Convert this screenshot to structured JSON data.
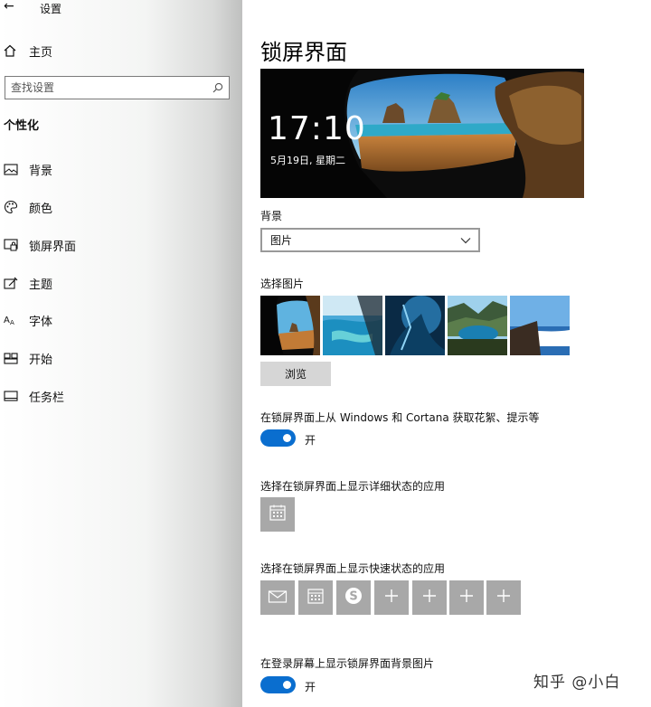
{
  "window": {
    "back_glyph": "←",
    "title": "设置"
  },
  "sidebar": {
    "home_label": "主页",
    "search_placeholder": "查找设置",
    "section_title": "个性化",
    "items": [
      {
        "label": "背景",
        "icon": "image-icon"
      },
      {
        "label": "颜色",
        "icon": "palette-icon"
      },
      {
        "label": "锁屏界面",
        "icon": "lock-screen-icon"
      },
      {
        "label": "主题",
        "icon": "theme-icon"
      },
      {
        "label": "字体",
        "icon": "font-icon"
      },
      {
        "label": "开始",
        "icon": "start-icon"
      },
      {
        "label": "任务栏",
        "icon": "taskbar-icon"
      }
    ]
  },
  "main": {
    "title": "锁屏界面",
    "preview": {
      "time": "17:10",
      "date": "5月19日, 星期二"
    },
    "background_label": "背景",
    "background_value": "图片",
    "choose_picture_label": "选择图片",
    "browse_label": "浏览",
    "tips_label": "在锁屏界面上从 Windows 和 Cortana 获取花絮、提示等",
    "tips_toggle": "开",
    "detailed_status_label": "选择在锁屏界面上显示详细状态的应用",
    "quick_status_label": "选择在锁屏界面上显示快速状态的应用",
    "signin_bg_label": "在登录屏幕上显示锁屏界面背景图片",
    "signin_toggle": "开",
    "quick_apps": [
      "mail-icon",
      "calendar-icon",
      "skype-icon",
      "add-icon",
      "add-icon",
      "add-icon",
      "add-icon"
    ]
  },
  "watermark": "知乎 @小白",
  "colors": {
    "accent": "#0a6ecf",
    "tile": "#a8a8a8",
    "button": "#d6d6d6"
  }
}
